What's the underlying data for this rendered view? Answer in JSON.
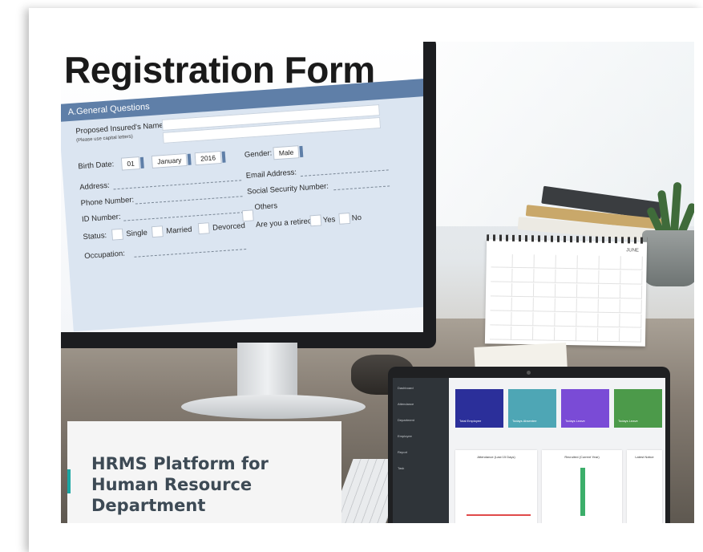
{
  "form": {
    "title": "Registration Form",
    "section": "A.General Questions",
    "fields": {
      "name": "Proposed Insured's Name:",
      "name_hint": "(Please use capital letters)",
      "birth_date": "Birth Date:",
      "day": "01",
      "month": "January",
      "year": "2016",
      "gender": "Gender:",
      "gender_value": "Male",
      "address": "Address:",
      "email": "Email Address:",
      "phone": "Phone Number:",
      "ssn": "Social Security Number:",
      "id": "ID Number:",
      "others": "Others",
      "status": "Status:",
      "single": "Single",
      "married": "Married",
      "divorced": "Devorced",
      "retired": "Are you a retired?",
      "yes": "Yes",
      "no": "No",
      "occupation": "Occupation:"
    }
  },
  "calendar": {
    "month": "JUNE"
  },
  "laptop": {
    "sidebar": [
      "Dashboard",
      "Attendance",
      "Department",
      "Employee",
      "Report",
      "Task"
    ],
    "tiles": [
      {
        "label": "Total Employee",
        "color": "#2b2f9a"
      },
      {
        "label": "Todays Absentee",
        "color": "#4ea6b5"
      },
      {
        "label": "Todays Leave",
        "color": "#7a4bd6"
      },
      {
        "label": "Todays Leave",
        "color": "#4c9a4a"
      }
    ],
    "panels": [
      {
        "title": "Attendance (Last 15 Days)"
      },
      {
        "title": "Recruited (Current Year)"
      },
      {
        "title": "Latest Notice"
      }
    ]
  },
  "caption": {
    "line1": "HRMS Platform for",
    "line2": "Human Resource",
    "line3": "Department"
  }
}
